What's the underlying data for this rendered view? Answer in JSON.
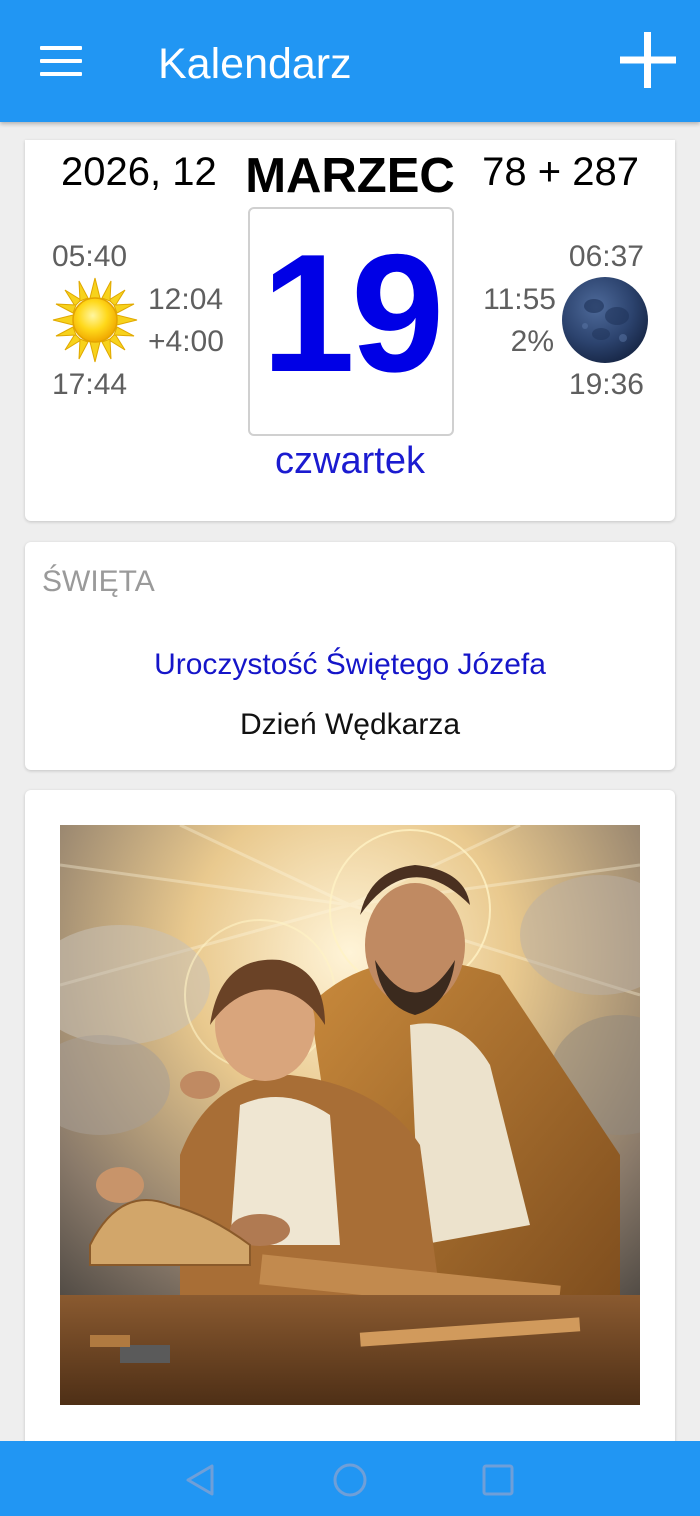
{
  "app": {
    "title": "Kalendarz"
  },
  "date_card": {
    "year_month": "2026, 12",
    "month_name": "MARZEC",
    "day_count": "78 + 287",
    "day_number": "19",
    "weekday": "czwartek",
    "sun": {
      "rise": "05:40",
      "noon": "12:04",
      "day_length": "+4:00",
      "set": "17:44",
      "icon": "sun-icon"
    },
    "moon": {
      "rise": "06:37",
      "culmination": "11:55",
      "illumination": "2%",
      "set": "19:36",
      "icon": "moon-icon"
    }
  },
  "holidays": {
    "header": "ŚWIĘTA",
    "items": [
      "Uroczystość Świętego Józefa",
      "Dzień Wędkarza"
    ]
  },
  "image_card": {
    "subject": "St. Joseph teaching young Jesus carpentry (illustration)"
  },
  "colors": {
    "primary": "#2196f3",
    "day_number": "#0000e6",
    "holiday_link": "#1515c9"
  },
  "navigation": {
    "buttons": [
      "back-icon",
      "home-icon",
      "recents-icon"
    ]
  }
}
